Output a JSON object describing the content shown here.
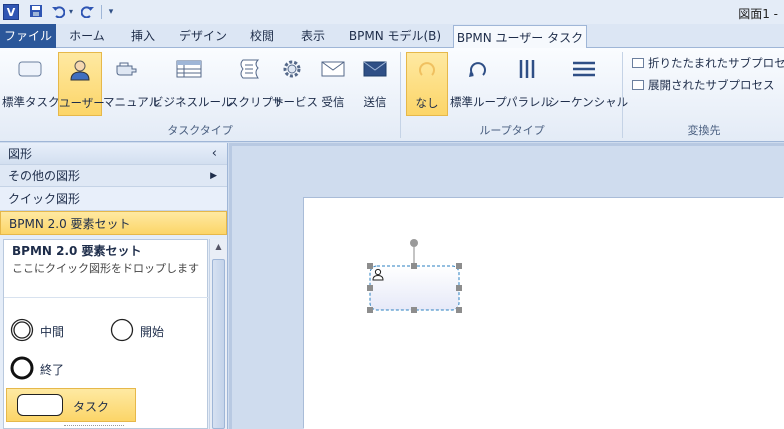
{
  "title_bar": {
    "doc_title": "図面1 - ",
    "app_icon": "V",
    "quick_access": [
      "save-icon",
      "undo-icon",
      "dropdown-arrow-icon",
      "redo-icon",
      "customize-icon"
    ]
  },
  "tabs": [
    "ファイル",
    "ホーム",
    "挿入",
    "デザイン",
    "校閲",
    "表示",
    "BPMN モデル(B)",
    "BPMN ユーザー タスク"
  ],
  "ribbon": {
    "task_type": {
      "label": "タスクタイプ",
      "items": [
        "標準タスク",
        "ユーザー",
        "マニュアル",
        "ビジネスルール",
        "スクリプト",
        "サービス",
        "受信",
        "送信"
      ]
    },
    "loop_type": {
      "label": "ループタイプ",
      "items": [
        "なし",
        "標準ループ",
        "パラレル",
        "シーケンシャル"
      ]
    },
    "convert_to": {
      "label": "変換先",
      "items": [
        "折りたたまれたサブプロセス",
        "展開されたサブプロセス"
      ]
    }
  },
  "shapes_pane": {
    "header": "図形",
    "collapse_glyph": "‹",
    "more_shapes": "その他の図形",
    "quick_shapes": "クイック図形",
    "bpmn_set": "BPMN 2.0 要素セット",
    "stencil_title": "BPMN 2.0 要素セット",
    "stencil_hint": "ここにクイック図形をドロップします",
    "items": [
      "中間",
      "開始",
      "終了",
      "タスク"
    ]
  },
  "colors": {
    "accent": "#2b579a",
    "selected": "#fcd568",
    "ribbon_icon": "#2f4f86"
  }
}
